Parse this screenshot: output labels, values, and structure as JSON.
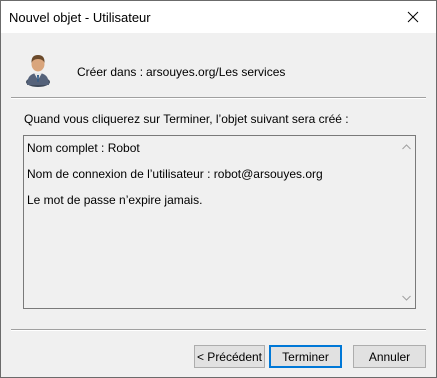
{
  "window": {
    "title": "Nouvel objet - Utilisateur"
  },
  "header": {
    "create_in_label": "Créer dans :",
    "create_in_path": "arsouyes.org/Les services"
  },
  "body": {
    "intro": "Quand vous cliquerez sur Terminer, l’objet suivant sera créé :",
    "summary_lines": [
      "Nom complet : Robot",
      "Nom de connexion de l’utilisateur : robot@arsouyes.org",
      "Le mot de passe n’expire jamais."
    ]
  },
  "buttons": {
    "previous": "< Précédent",
    "finish": "Terminer",
    "cancel": "Annuler"
  },
  "icons": {
    "close": "close-icon",
    "user": "user-icon",
    "scroll_up": "chevron-up-icon",
    "scroll_down": "chevron-down-icon"
  },
  "colors": {
    "focus_border": "#0078d7",
    "dialog_background": "#f0f0f0",
    "titlebar_background": "#ffffff"
  }
}
